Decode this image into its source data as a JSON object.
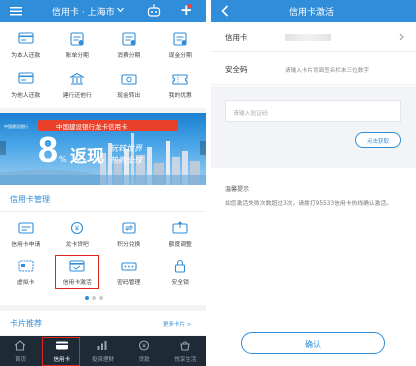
{
  "left": {
    "header": {
      "title": "信用卡 · 上海市",
      "location_chevron": "chevron-down-icon",
      "add_symbol": "+"
    },
    "quick_grid": [
      {
        "label": "为本人还款",
        "icon": "card-repay-icon"
      },
      {
        "label": "账单分期",
        "icon": "bill-installment-icon"
      },
      {
        "label": "消费分期",
        "icon": "consume-installment-icon"
      },
      {
        "label": "现金分期",
        "icon": "cash-installment-icon"
      },
      {
        "label": "为他人还款",
        "icon": "repay-others-icon"
      },
      {
        "label": "建行还他行",
        "icon": "bank-transfer-icon"
      },
      {
        "label": "现金转出",
        "icon": "cash-out-icon"
      },
      {
        "label": "我的优惠",
        "icon": "coupon-icon"
      }
    ],
    "banner": {
      "top_text": "中国建设银行龙卡信用卡",
      "small_text": "中国建设银行",
      "percent_number": "8",
      "percent_sign": "%",
      "fanxian": "返现",
      "slogan1": "玩转世界",
      "slogan2": "热购全球"
    },
    "section_title": "信用卡管理",
    "manage_grid": [
      {
        "label": "信用卡申请",
        "icon": "card-apply-icon"
      },
      {
        "label": "龙卡贷吧",
        "icon": "loan-icon"
      },
      {
        "label": "积分兑换",
        "icon": "points-exchange-icon"
      },
      {
        "label": "额度调整",
        "icon": "limit-adjust-icon"
      },
      {
        "label": "虚拟卡",
        "icon": "virtual-card-icon"
      },
      {
        "label": "信用卡激活",
        "icon": "card-activate-icon"
      },
      {
        "label": "密码管理",
        "icon": "password-icon"
      },
      {
        "label": "安全锁",
        "icon": "lock-icon"
      }
    ],
    "recommend": {
      "title": "卡片推荐",
      "more": "更多卡片 >"
    },
    "tabbar": [
      {
        "label": "首页",
        "icon": "home-icon"
      },
      {
        "label": "信用卡",
        "icon": "credit-card-icon"
      },
      {
        "label": "投资理财",
        "icon": "investment-icon"
      },
      {
        "label": "贷款",
        "icon": "loan-coin-icon"
      },
      {
        "label": "悦享生活",
        "icon": "life-icon"
      }
    ],
    "highlight_color": "#e0261f"
  },
  "right": {
    "header": {
      "title": "信用卡激活"
    },
    "card_label": "信用卡",
    "security_label": "安全码",
    "security_hint": "请输入卡片背面签名栏末三位数字",
    "code_placeholder": "请输入验证码",
    "get_code": "点击获取",
    "tips_title": "温馨提示",
    "tips_body": "如您激活失败次数超过3次，请拨打95533信用卡热线确认激活。",
    "confirm": "确认"
  },
  "colors": {
    "brand": "#2f8dd9",
    "accent": "#1a73c8",
    "nav_bg": "#1f2a37"
  }
}
